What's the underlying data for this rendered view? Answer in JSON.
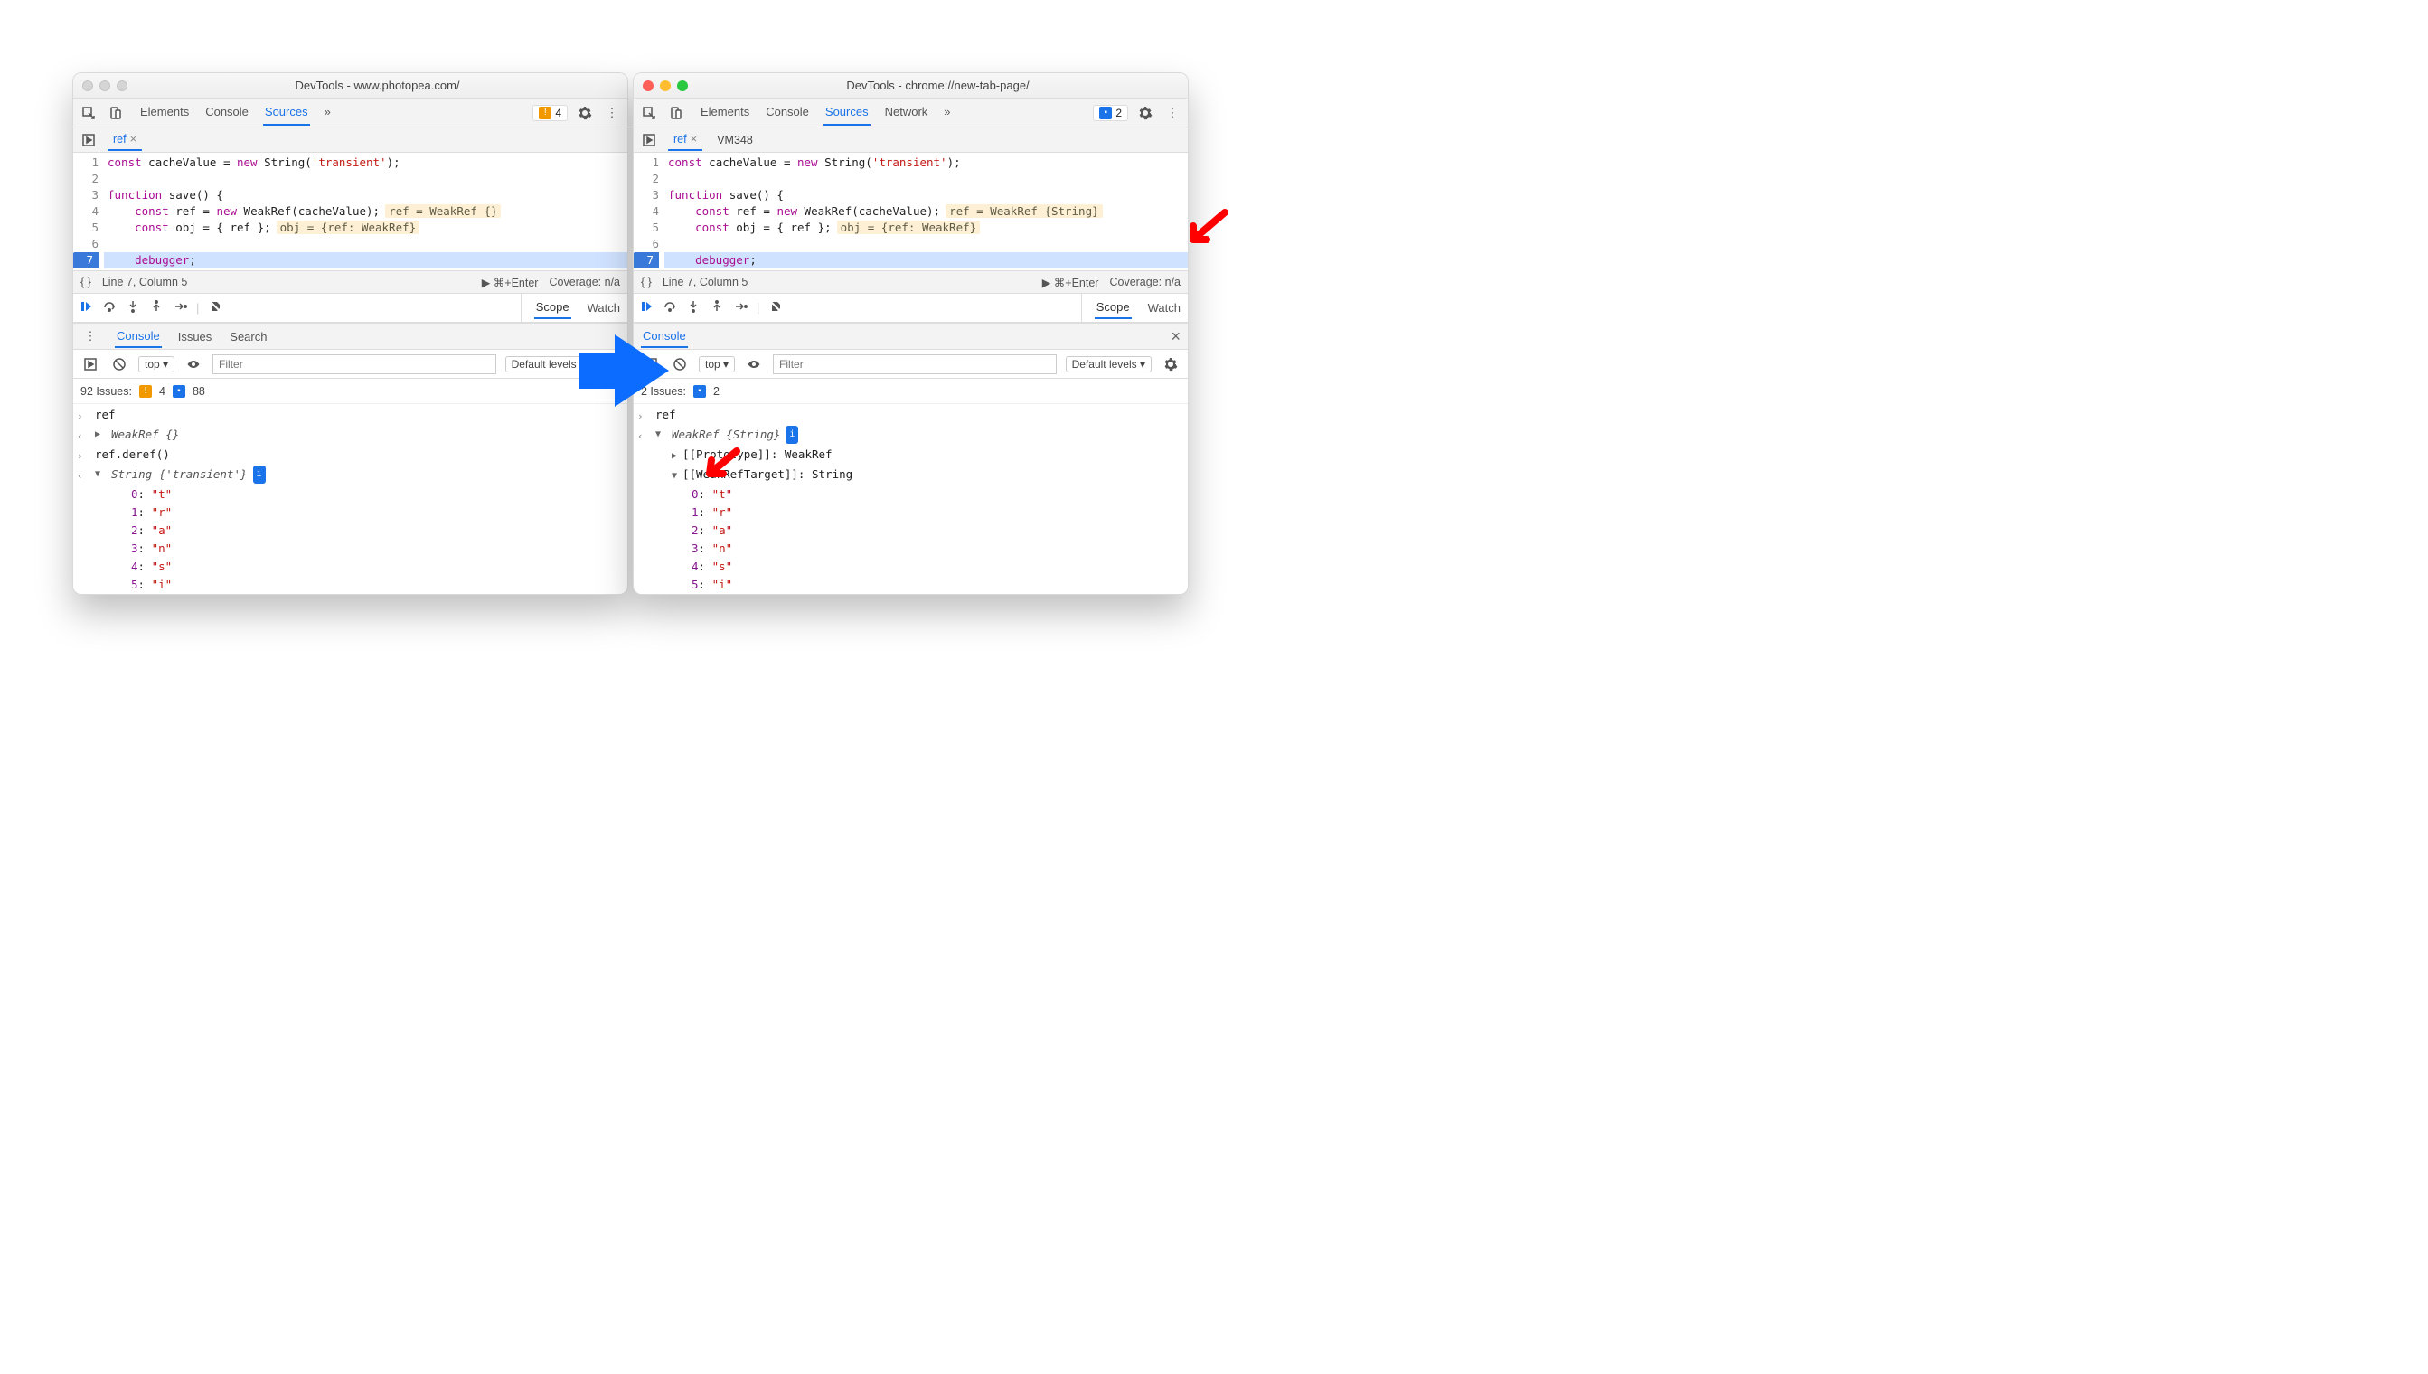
{
  "left": {
    "title": "DevTools - www.photopea.com/",
    "traffic_active": false,
    "top_tabs": [
      "Elements",
      "Console",
      "Sources"
    ],
    "top_tabs_active": "Sources",
    "top_more": "»",
    "warn_count": "4",
    "sub_tabs": [
      {
        "name": "ref",
        "closable": true
      }
    ],
    "code": {
      "lines": [
        {
          "n": "1",
          "text": "const cacheValue = new String('transient');",
          "hint": ""
        },
        {
          "n": "2",
          "text": "",
          "hint": ""
        },
        {
          "n": "3",
          "text": "function save() {",
          "hint": ""
        },
        {
          "n": "4",
          "text": "    const ref = new WeakRef(cacheValue);",
          "hint": "ref = WeakRef {}"
        },
        {
          "n": "5",
          "text": "    const obj = { ref };",
          "hint": "obj = {ref: WeakRef}"
        },
        {
          "n": "6",
          "text": "",
          "hint": ""
        },
        {
          "n": "7",
          "text": "    debugger;",
          "hint": "",
          "exec": true
        }
      ]
    },
    "status": {
      "pos": "Line 7, Column 5",
      "run": "▶ ⌘+Enter",
      "coverage": "Coverage: n/a"
    },
    "dbg_tabs": [
      "Scope",
      "Watch"
    ],
    "dbg_tabs_active": "Scope",
    "drawer_tabs": [
      "Console",
      "Issues",
      "Search"
    ],
    "drawer_active": "Console",
    "context": "top ▾",
    "filter_placeholder": "Filter",
    "levels": "Default levels ▾",
    "issues": {
      "label": "92 Issues:",
      "warn": "4",
      "info": "88"
    },
    "console_rows": [
      {
        "type": "in",
        "text": "ref"
      },
      {
        "type": "out",
        "tri": "▶",
        "text": "WeakRef {}"
      },
      {
        "type": "in",
        "text": "ref.deref()"
      },
      {
        "type": "out",
        "tri": "▼",
        "text": "String {'transient'}",
        "badge": "i"
      },
      {
        "type": "kv",
        "k": "0",
        "v": "\"t\""
      },
      {
        "type": "kv",
        "k": "1",
        "v": "\"r\""
      },
      {
        "type": "kv",
        "k": "2",
        "v": "\"a\""
      },
      {
        "type": "kv",
        "k": "3",
        "v": "\"n\""
      },
      {
        "type": "kv",
        "k": "4",
        "v": "\"s\""
      },
      {
        "type": "kv",
        "k": "5",
        "v": "\"i\""
      }
    ]
  },
  "right": {
    "title": "DevTools - chrome://new-tab-page/",
    "traffic_active": true,
    "top_tabs": [
      "Elements",
      "Console",
      "Sources",
      "Network"
    ],
    "top_tabs_active": "Sources",
    "top_more": "»",
    "info_count": "2",
    "sub_tabs": [
      {
        "name": "ref",
        "closable": true
      },
      {
        "name": "VM348",
        "closable": false
      }
    ],
    "code": {
      "lines": [
        {
          "n": "1",
          "text": "const cacheValue = new String('transient');",
          "hint": ""
        },
        {
          "n": "2",
          "text": "",
          "hint": ""
        },
        {
          "n": "3",
          "text": "function save() {",
          "hint": ""
        },
        {
          "n": "4",
          "text": "    const ref = new WeakRef(cacheValue);",
          "hint": "ref = WeakRef {String}"
        },
        {
          "n": "5",
          "text": "    const obj = { ref };",
          "hint": "obj = {ref: WeakRef}"
        },
        {
          "n": "6",
          "text": "",
          "hint": ""
        },
        {
          "n": "7",
          "text": "    debugger;",
          "hint": "",
          "exec": true
        }
      ]
    },
    "status": {
      "pos": "Line 7, Column 5",
      "run": "▶ ⌘+Enter",
      "coverage": "Coverage: n/a"
    },
    "dbg_tabs": [
      "Scope",
      "Watch"
    ],
    "dbg_tabs_active": "Scope",
    "drawer_tabs": [
      "Console"
    ],
    "drawer_active": "Console",
    "context": "top ▾",
    "filter_placeholder": "Filter",
    "levels": "Default levels ▾",
    "issues": {
      "label": "2 Issues:",
      "info": "2"
    },
    "console_rows": [
      {
        "type": "in",
        "text": "ref"
      },
      {
        "type": "out",
        "tri": "▼",
        "text": "WeakRef {String}",
        "badge": "i"
      },
      {
        "type": "proto",
        "tri": "▶",
        "k": "[[Prototype]]",
        "v": "WeakRef"
      },
      {
        "type": "proto",
        "tri": "▼",
        "k": "[[WeakRefTarget]]",
        "v": "String"
      },
      {
        "type": "kv",
        "k": "0",
        "v": "\"t\""
      },
      {
        "type": "kv",
        "k": "1",
        "v": "\"r\""
      },
      {
        "type": "kv",
        "k": "2",
        "v": "\"a\""
      },
      {
        "type": "kv",
        "k": "3",
        "v": "\"n\""
      },
      {
        "type": "kv",
        "k": "4",
        "v": "\"s\""
      },
      {
        "type": "kv",
        "k": "5",
        "v": "\"i\""
      }
    ]
  }
}
